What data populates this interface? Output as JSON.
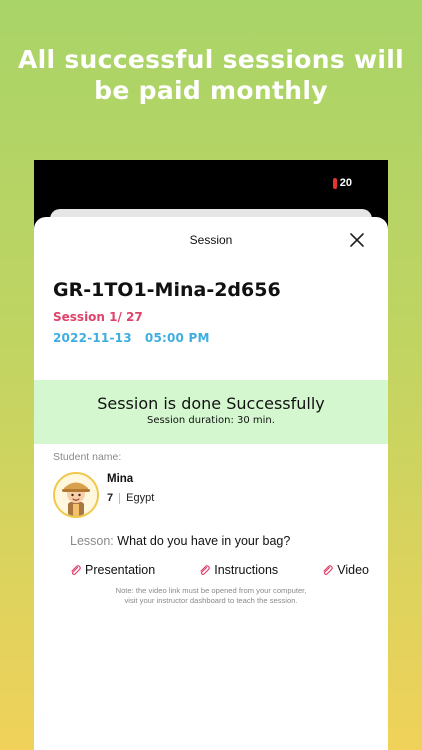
{
  "headline": {
    "line1": "All successful sessions will",
    "line2": "be paid monthly"
  },
  "status_bar": {
    "battery_level": "20",
    "battery_color": "#e5342b"
  },
  "sheet": {
    "title": "Session",
    "close_icon": "close-icon"
  },
  "session": {
    "code": "GR-1TO1-Mina-2d656",
    "count": "Session 1/ 27",
    "date": "2022-11-13",
    "time": "05:00 PM",
    "count_color": "#e0436a",
    "datetime_color": "#3eaee0"
  },
  "status": {
    "title": "Session is done Successfully",
    "duration": "Session duration: 30 min.",
    "banner_color": "#d4f7cf"
  },
  "student": {
    "label": "Student name:",
    "name": "Mina",
    "age": "7",
    "country": "Egypt",
    "avatar_icon": "child-avatar-icon"
  },
  "lesson": {
    "label": "Lesson:",
    "title": "What do you have in your bag?"
  },
  "links": [
    {
      "label": "Presentation",
      "icon": "paperclip-icon"
    },
    {
      "label": "Instructions",
      "icon": "paperclip-icon"
    },
    {
      "label": "Video",
      "icon": "paperclip-icon"
    }
  ],
  "note": {
    "line1": "Note: the video link must be opened from your computer,",
    "line2": "visit your instructor dashboard to teach the session."
  }
}
